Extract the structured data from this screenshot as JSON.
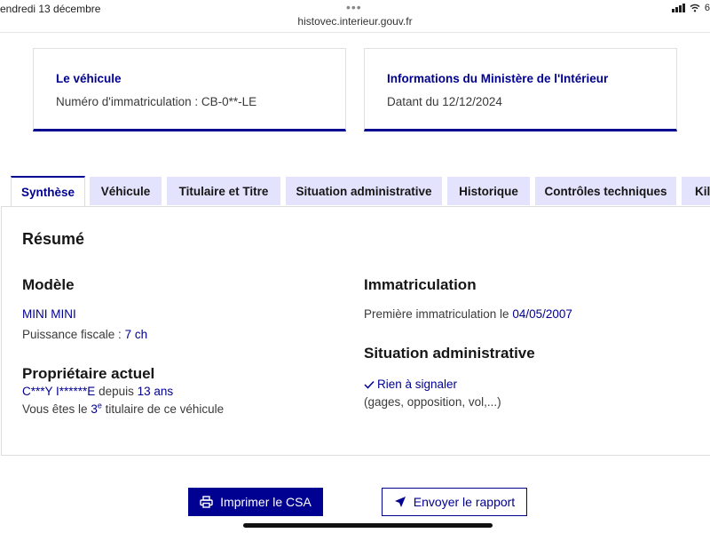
{
  "status_bar": {
    "date": "endredi 13 décembre",
    "dots": "•••",
    "url": "histovec.interieur.gouv.fr",
    "battery_fragment": "6"
  },
  "cards": {
    "vehicle": {
      "title": "Le véhicule",
      "text": "Numéro d'immatriculation : CB-0**-LE"
    },
    "ministry": {
      "title": "Informations du Ministère de l'Intérieur",
      "text": "Datant du 12/12/2024"
    }
  },
  "tabs": [
    {
      "label": "Synthèse",
      "active": true
    },
    {
      "label": "Véhicule"
    },
    {
      "label": "Titulaire et Titre"
    },
    {
      "label": "Situation administrative"
    },
    {
      "label": "Historique"
    },
    {
      "label": "Contrôles techniques"
    },
    {
      "label": "Kil"
    }
  ],
  "summary": {
    "heading": "Résumé",
    "modele": {
      "heading": "Modèle",
      "name": "MINI MINI",
      "puissance_label": "Puissance fiscale : ",
      "puissance_value": "7 ch"
    },
    "proprietaire": {
      "heading": "Propriétaire actuel",
      "owner": "C***Y I******E",
      "depuis_label": " depuis ",
      "depuis_value": "13 ans",
      "rank_prefix": "Vous êtes le ",
      "rank_number": "3",
      "rank_sup": "e",
      "rank_suffix": " titulaire de ce véhicule"
    },
    "immatriculation": {
      "heading": "Immatriculation",
      "label": "Première immatriculation le ",
      "date": "04/05/2007"
    },
    "situation": {
      "heading": "Situation administrative",
      "status": "Rien à signaler",
      "detail": "(gages, opposition, vol,...)"
    }
  },
  "actions": {
    "print_label": "Imprimer le CSA",
    "send_label": "Envoyer le rapport"
  },
  "colors": {
    "primary": "#000091",
    "tab_background": "#e3e3fd",
    "text": "#3a3a3a"
  },
  "icons": [
    "wifi-icon",
    "signal-icon",
    "check-icon",
    "printer-icon",
    "send-icon"
  ]
}
